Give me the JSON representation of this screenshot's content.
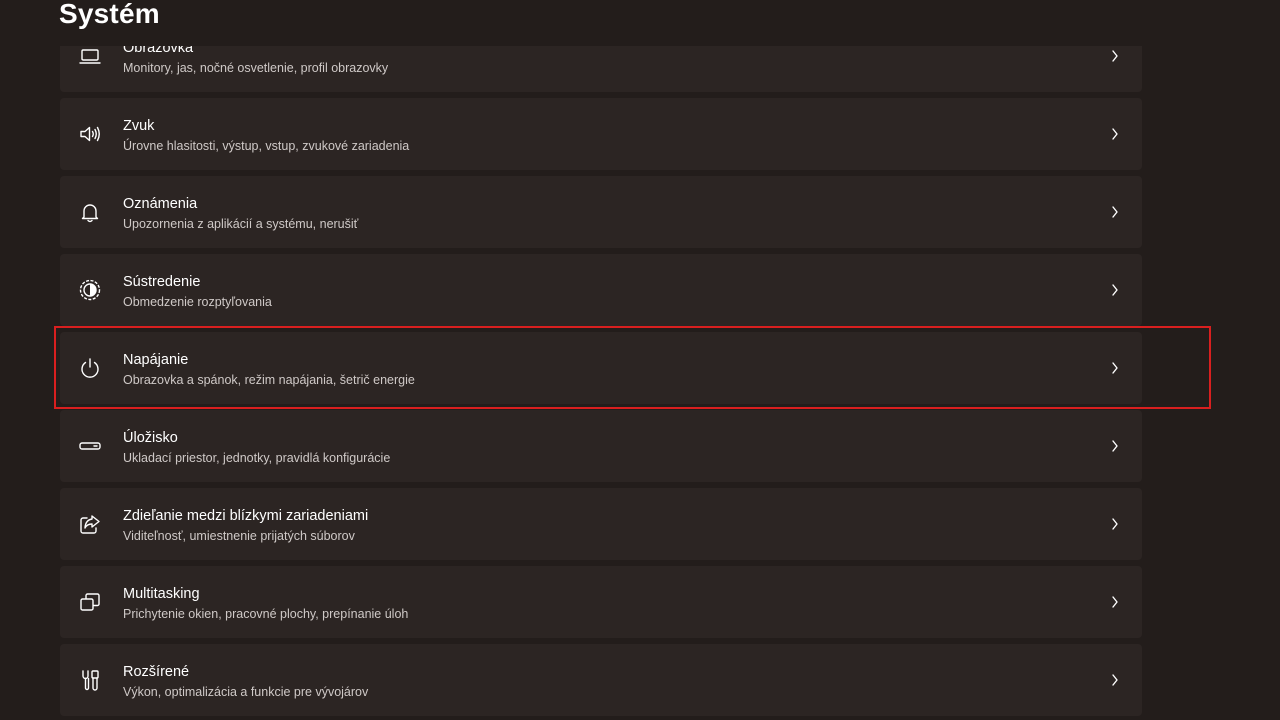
{
  "page": {
    "title": "Systém"
  },
  "accent": {
    "highlight_color": "#d91f1f"
  },
  "settings": {
    "items": [
      {
        "icon": "monitor-icon",
        "title": "Obrazovka",
        "description": "Monitory, jas, nočné osvetlenie, profil obrazovky"
      },
      {
        "icon": "speaker-icon",
        "title": "Zvuk",
        "description": "Úrovne hlasitosti, výstup, vstup, zvukové zariadenia"
      },
      {
        "icon": "bell-icon",
        "title": "Oznámenia",
        "description": "Upozornenia z aplikácií a systému, nerušiť"
      },
      {
        "icon": "focus-icon",
        "title": "Sústredenie",
        "description": "Obmedzenie rozptyľovania"
      },
      {
        "icon": "power-icon",
        "title": "Napájanie",
        "description": "Obrazovka a spánok, režim napájania, šetrič energie"
      },
      {
        "icon": "storage-icon",
        "title": "Úložisko",
        "description": "Ukladací priestor, jednotky, pravidlá konfigurácie"
      },
      {
        "icon": "share-icon",
        "title": "Zdieľanie medzi blízkymi zariadeniami",
        "description": "Viditeľnosť, umiestnenie prijatých súborov"
      },
      {
        "icon": "multitasking-icon",
        "title": "Multitasking",
        "description": "Prichytenie okien, pracovné plochy, prepínanie úloh"
      },
      {
        "icon": "tools-icon",
        "title": "Rozšírené",
        "description": "Výkon, optimalizácia a funkcie pre vývojárov"
      }
    ]
  }
}
